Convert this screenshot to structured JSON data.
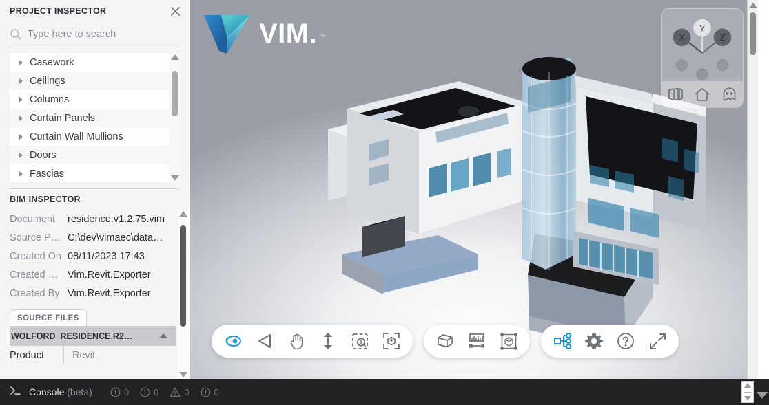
{
  "sidebar": {
    "title": "PROJECT INSPECTOR",
    "close_icon": "close-icon",
    "search": {
      "icon": "search-icon",
      "placeholder": "Type here to search",
      "value": ""
    },
    "tree_items": [
      {
        "label": "Casework"
      },
      {
        "label": "Ceilings"
      },
      {
        "label": "Columns"
      },
      {
        "label": "Curtain Panels"
      },
      {
        "label": "Curtain Wall Mullions"
      },
      {
        "label": "Doors"
      },
      {
        "label": "Fascias"
      }
    ],
    "bim": {
      "title": "BIM INSPECTOR",
      "rows": [
        {
          "key": "Document",
          "value": "residence.v1.2.75.vim"
        },
        {
          "key": "Source P…",
          "value": "C:\\dev\\vimaec\\data…"
        },
        {
          "key": "Created On",
          "value": "08/11/2023 17:43"
        },
        {
          "key": "Created …",
          "value": "Vim.Revit.Exporter"
        },
        {
          "key": "Created By",
          "value": "Vim.Revit.Exporter"
        }
      ],
      "tab_label": "SOURCE FILES",
      "source_file": "WOLFORD_RESIDENCE.R2…",
      "properties": [
        {
          "key": "Product",
          "value": "Revit"
        }
      ]
    }
  },
  "viewer": {
    "logo_text": "VIM",
    "logo_dot": ".",
    "logo_tm": "™",
    "gizmo": {
      "axis_x": "X",
      "axis_y": "Y",
      "axis_z": "Z",
      "buttons": [
        {
          "name": "sections-icon",
          "label": "Sections"
        },
        {
          "name": "home-icon",
          "label": "Home"
        },
        {
          "name": "ghost-icon",
          "label": "Ghost"
        }
      ]
    },
    "toolbar": {
      "accent_color": "#1a9ad6",
      "inactive_color": "#6f7279",
      "groups": [
        {
          "name": "navigation-group",
          "buttons": [
            {
              "name": "orbit-icon",
              "label": "Orbit",
              "active": true
            },
            {
              "name": "look-around-icon",
              "label": "Look Around",
              "active": false
            },
            {
              "name": "pan-icon",
              "label": "Pan",
              "active": false
            },
            {
              "name": "zoom-icon",
              "label": "Zoom",
              "active": false
            },
            {
              "name": "zoom-window-icon",
              "label": "Zoom Window",
              "active": false
            },
            {
              "name": "zoom-to-fit-icon",
              "label": "Zoom to Fit",
              "active": false
            }
          ]
        },
        {
          "name": "tools-group",
          "buttons": [
            {
              "name": "section-box-icon",
              "label": "Section Box",
              "active": false
            },
            {
              "name": "measure-icon",
              "label": "Measure",
              "active": false
            },
            {
              "name": "isolate-icon",
              "label": "Isolate",
              "active": false
            }
          ]
        },
        {
          "name": "settings-group",
          "buttons": [
            {
              "name": "project-tree-icon",
              "label": "Project Inspector",
              "active": true
            },
            {
              "name": "gear-icon",
              "label": "Settings",
              "active": false
            },
            {
              "name": "help-icon",
              "label": "Help",
              "active": false
            },
            {
              "name": "fullscreen-icon",
              "label": "Full Screen",
              "active": false
            }
          ]
        }
      ]
    }
  },
  "console": {
    "prompt_icon": "terminal-icon",
    "label": "Console",
    "beta": " (beta)",
    "counters": [
      {
        "icon": "info-icon",
        "count": "0"
      },
      {
        "icon": "info-icon",
        "count": "0"
      },
      {
        "icon": "warning-icon",
        "count": "0"
      },
      {
        "icon": "error-icon",
        "count": "0"
      }
    ]
  }
}
